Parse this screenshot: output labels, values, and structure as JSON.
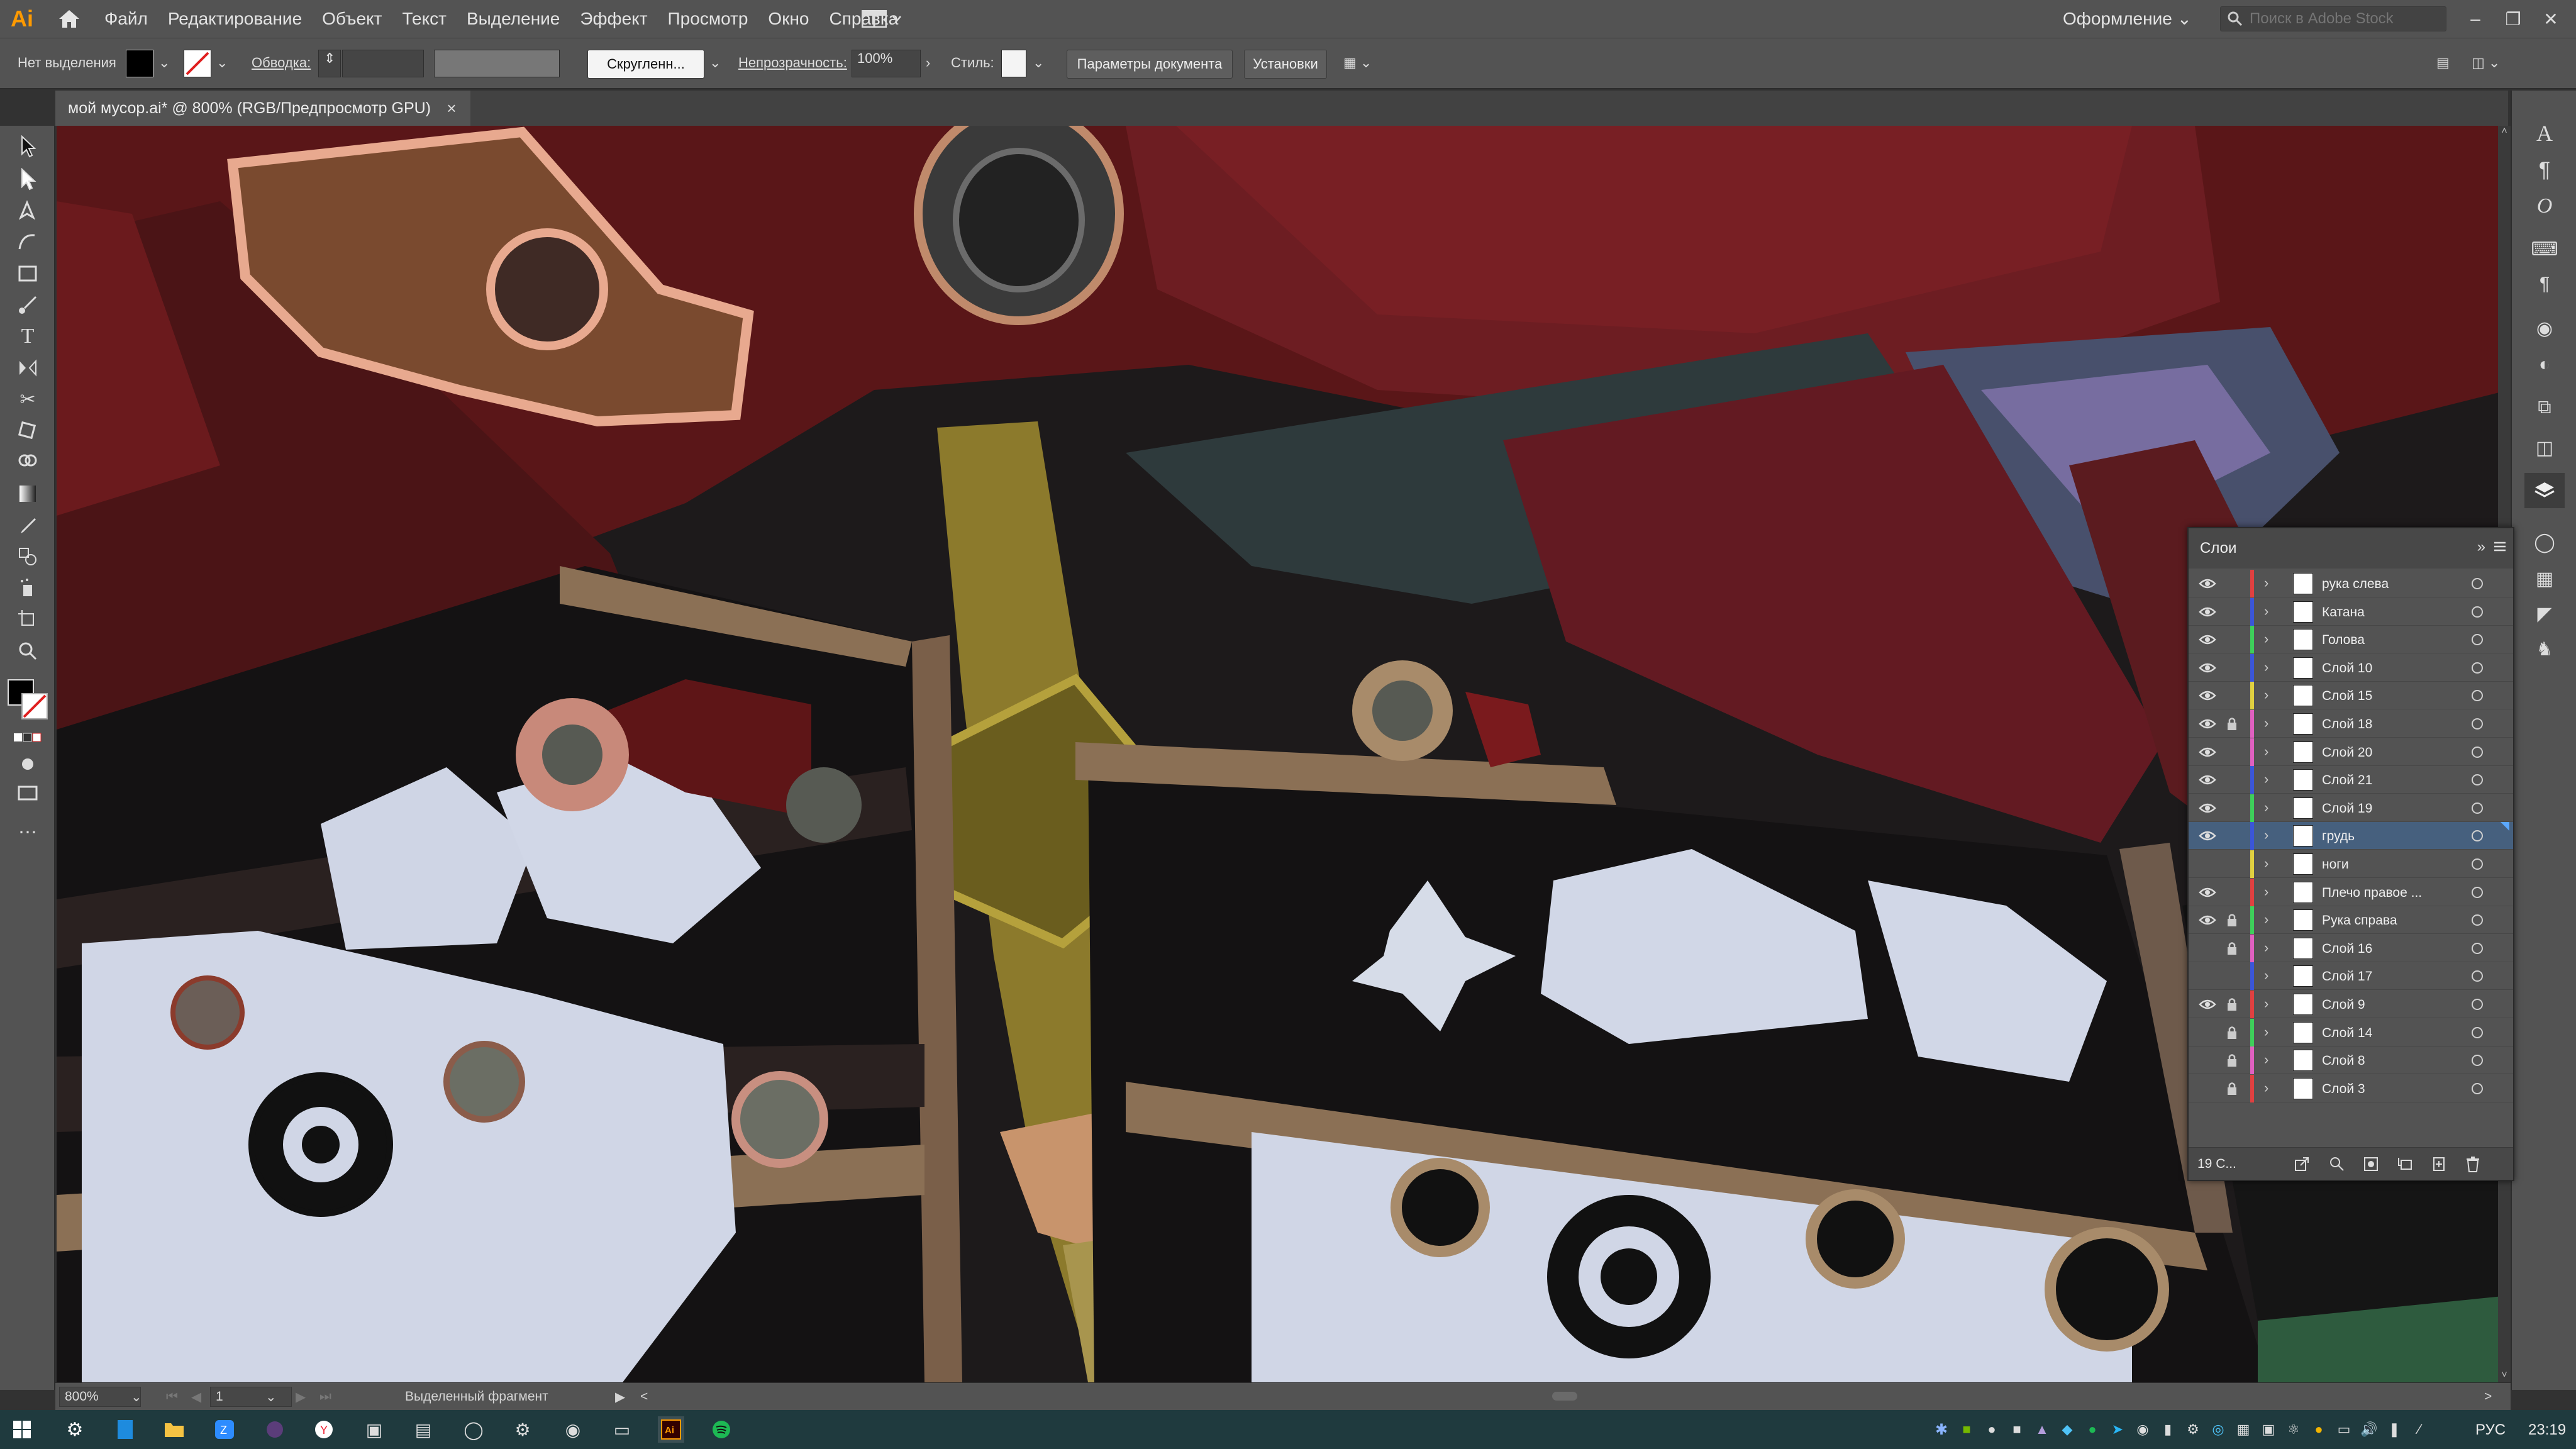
{
  "app": {
    "logo": "Ai",
    "menu": [
      "Файл",
      "Редактирование",
      "Объект",
      "Текст",
      "Выделение",
      "Эффект",
      "Просмотр",
      "Окно",
      "Справка"
    ],
    "workspace": "Оформление",
    "stock_search_placeholder": "Поиск в Adobe Stock"
  },
  "controlbar": {
    "selection_label": "Нет выделения",
    "stroke_label": "Обводка:",
    "brush_label": "Скругленн...",
    "opacity_label": "Непрозрачность:",
    "opacity_value": "100%",
    "style_label": "Стиль:",
    "doc_params_button": "Параметры документа",
    "settings_button": "Установки"
  },
  "document_tab": {
    "title": "мой мусор.ai* @ 800% (RGB/Предпросмотр GPU)",
    "close": "×"
  },
  "layers_panel": {
    "title": "Слои",
    "count_label": "19 С...",
    "layers": [
      {
        "name": "рука слева",
        "visible": true,
        "locked": false,
        "color": "#e04040",
        "selected": false
      },
      {
        "name": "Катана",
        "visible": true,
        "locked": false,
        "color": "#3b56d8",
        "selected": false
      },
      {
        "name": "Голова",
        "visible": true,
        "locked": false,
        "color": "#3ecf5a",
        "selected": false
      },
      {
        "name": "Слой 10",
        "visible": true,
        "locked": false,
        "color": "#3b56d8",
        "selected": false
      },
      {
        "name": "Слой 15",
        "visible": true,
        "locked": false,
        "color": "#e0d040",
        "selected": false
      },
      {
        "name": "Слой 18",
        "visible": true,
        "locked": true,
        "color": "#e060c0",
        "selected": false
      },
      {
        "name": "Слой 20",
        "visible": true,
        "locked": false,
        "color": "#e060c0",
        "selected": false
      },
      {
        "name": "Слой 21",
        "visible": true,
        "locked": false,
        "color": "#3b56d8",
        "selected": false
      },
      {
        "name": "Слой 19",
        "visible": true,
        "locked": false,
        "color": "#3ecf5a",
        "selected": false
      },
      {
        "name": "грудь",
        "visible": true,
        "locked": false,
        "color": "#3b56d8",
        "selected": true
      },
      {
        "name": "ноги",
        "visible": false,
        "locked": false,
        "color": "#e0d040",
        "selected": false
      },
      {
        "name": "Плечо правое ...",
        "visible": true,
        "locked": false,
        "color": "#e04040",
        "selected": false
      },
      {
        "name": "Рука справа",
        "visible": true,
        "locked": true,
        "color": "#3ecf5a",
        "selected": false
      },
      {
        "name": "Слой 16",
        "visible": false,
        "locked": true,
        "color": "#e060c0",
        "selected": false
      },
      {
        "name": "Слой 17",
        "visible": false,
        "locked": false,
        "color": "#3b56d8",
        "selected": false
      },
      {
        "name": "Слой 9",
        "visible": true,
        "locked": true,
        "color": "#e04040",
        "selected": false
      },
      {
        "name": "Слой 14",
        "visible": false,
        "locked": true,
        "color": "#3ecf5a",
        "selected": false
      },
      {
        "name": "Слой 8",
        "visible": false,
        "locked": true,
        "color": "#e060c0",
        "selected": false
      },
      {
        "name": "Слой 3",
        "visible": false,
        "locked": true,
        "color": "#e04040",
        "selected": false
      }
    ]
  },
  "statusbar": {
    "zoom": "800%",
    "artboard": "1",
    "tool_info": "Выделенный фрагмент"
  },
  "taskbar": {
    "language": "РУС",
    "clock": "23:19"
  },
  "colors": {
    "ui_panel": "#535353",
    "ui_dark": "#323232",
    "selection_blue": "#46607e",
    "ai_orange": "#ff9a00",
    "taskbar": "#1f3a3e"
  },
  "icons": [
    "home-icon",
    "workspace-switcher-icon",
    "search-icon",
    "eye-icon",
    "lock-icon",
    "layer-thumbnail",
    "target-icon",
    "collapse-icon",
    "panel-menu-icon",
    "windows-start-icon"
  ]
}
